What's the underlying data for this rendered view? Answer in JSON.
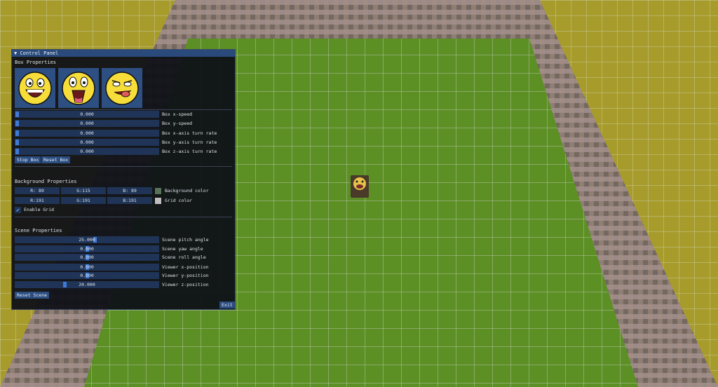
{
  "panel": {
    "title": "Control Panel",
    "box": {
      "heading": "Box Properties",
      "sliders": [
        {
          "value": "0.000",
          "label": "Box x-speed",
          "fraction": 0.0
        },
        {
          "value": "0.000",
          "label": "Box y-speed",
          "fraction": 0.0
        },
        {
          "value": "0.000",
          "label": "Box x-axis turn rate",
          "fraction": 0.0
        },
        {
          "value": "0.000",
          "label": "Box y-axis turn rate",
          "fraction": 0.0
        },
        {
          "value": "0.000",
          "label": "Box z-axis turn rate",
          "fraction": 0.0
        }
      ],
      "stop_label": "Stop Box",
      "reset_label": "Reset Box"
    },
    "background": {
      "heading": "Background Properties",
      "bg": {
        "r": "R: 89",
        "g": "G:115",
        "b": "B: 89",
        "label": "Background color",
        "color": "#597359"
      },
      "grid": {
        "r": "R:191",
        "g": "G:191",
        "b": "B:191",
        "label": "Grid color",
        "color": "#bfbfbf"
      },
      "enable_grid_label": "Enable Grid",
      "enable_grid": true
    },
    "scene": {
      "heading": "Scene Properties",
      "sliders": [
        {
          "value": "25.000",
          "label": "Scene pitch angle",
          "fraction": 0.56
        },
        {
          "value": "0.000",
          "label": "Scene yaw angle",
          "fraction": 0.5
        },
        {
          "value": "0.000",
          "label": "Scene roll angle",
          "fraction": 0.5
        },
        {
          "value": "0.000",
          "label": "Viewer x-position",
          "fraction": 0.5
        },
        {
          "value": "0.000",
          "label": "Viewer y-position",
          "fraction": 0.5
        },
        {
          "value": "20.000",
          "label": "Viewer z-position",
          "fraction": 0.34
        }
      ],
      "reset_label": "Reset Scene"
    },
    "exit_label": "Exit"
  },
  "colors": {
    "grass": "#5c8f24",
    "brick": "#8a7a72",
    "sand": "#a39a2a",
    "grid": "#bfbfbf"
  }
}
